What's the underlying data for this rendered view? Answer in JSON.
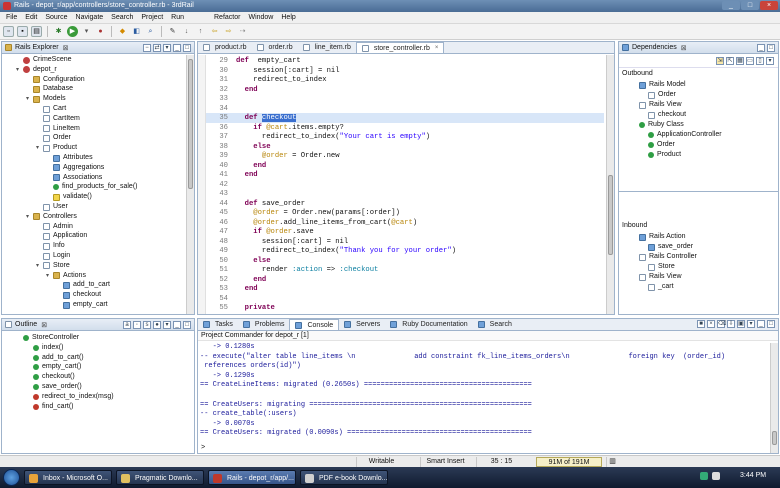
{
  "window": {
    "title": "Rails - depot_r/app/controllers/store_controller.rb - 3rdRail"
  },
  "menu": [
    "File",
    "Edit",
    "Source",
    "Navigate",
    "Search",
    "Project",
    "Run",
    "Refactor",
    "Window",
    "Help"
  ],
  "explorer": {
    "title": "Rails Explorer",
    "items": [
      {
        "label": "CrimeScene",
        "indent": 1,
        "icon": "db",
        "twisty": ""
      },
      {
        "label": "depot_r",
        "indent": 1,
        "icon": "db",
        "twisty": "▾"
      },
      {
        "label": "Configuration",
        "indent": 2,
        "icon": "folder",
        "twisty": ""
      },
      {
        "label": "Database",
        "indent": 2,
        "icon": "folder",
        "twisty": ""
      },
      {
        "label": "Models",
        "indent": 2,
        "icon": "folder",
        "twisty": "▾"
      },
      {
        "label": "Cart",
        "indent": 3,
        "icon": "file",
        "twisty": ""
      },
      {
        "label": "CartItem",
        "indent": 3,
        "icon": "file",
        "twisty": ""
      },
      {
        "label": "LineItem",
        "indent": 3,
        "icon": "file",
        "twisty": ""
      },
      {
        "label": "Order",
        "indent": 3,
        "icon": "file",
        "twisty": ""
      },
      {
        "label": "Product",
        "indent": 3,
        "icon": "file",
        "twisty": "▾"
      },
      {
        "label": "Attributes",
        "indent": 4,
        "icon": "blue",
        "twisty": ""
      },
      {
        "label": "Aggregations",
        "indent": 4,
        "icon": "blue",
        "twisty": ""
      },
      {
        "label": "Associations",
        "indent": 4,
        "icon": "blue",
        "twisty": ""
      },
      {
        "label": "find_products_for_sale()",
        "indent": 4,
        "icon": "dot",
        "twisty": ""
      },
      {
        "label": "validate()",
        "indent": 4,
        "icon": "yellow",
        "twisty": ""
      },
      {
        "label": "User",
        "indent": 3,
        "icon": "file",
        "twisty": ""
      },
      {
        "label": "Controllers",
        "indent": 2,
        "icon": "folder",
        "twisty": "▾"
      },
      {
        "label": "Admin",
        "indent": 3,
        "icon": "file",
        "twisty": ""
      },
      {
        "label": "Application",
        "indent": 3,
        "icon": "file",
        "twisty": ""
      },
      {
        "label": "Info",
        "indent": 3,
        "icon": "file",
        "twisty": ""
      },
      {
        "label": "Login",
        "indent": 3,
        "icon": "file",
        "twisty": ""
      },
      {
        "label": "Store",
        "indent": 3,
        "icon": "file",
        "twisty": "▾"
      },
      {
        "label": "Actions",
        "indent": 4,
        "icon": "folder",
        "twisty": "▾"
      },
      {
        "label": "add_to_cart",
        "indent": 5,
        "icon": "blue",
        "twisty": ""
      },
      {
        "label": "checkout",
        "indent": 5,
        "icon": "blue",
        "twisty": ""
      },
      {
        "label": "empty_cart",
        "indent": 5,
        "icon": "blue",
        "twisty": ""
      }
    ]
  },
  "outline": {
    "title": "Outline",
    "items": [
      {
        "label": "StoreController",
        "indent": 1,
        "icon": "dot"
      },
      {
        "label": "index()",
        "indent": 2,
        "icon": "dot"
      },
      {
        "label": "add_to_cart()",
        "indent": 2,
        "icon": "dot"
      },
      {
        "label": "empty_cart()",
        "indent": 2,
        "icon": "dot"
      },
      {
        "label": "checkout()",
        "indent": 2,
        "icon": "dot"
      },
      {
        "label": "save_order()",
        "indent": 2,
        "icon": "dot"
      },
      {
        "label": "redirect_to_index(msg)",
        "indent": 2,
        "icon": "reddot"
      },
      {
        "label": "find_cart()",
        "indent": 2,
        "icon": "reddot"
      }
    ]
  },
  "editor": {
    "tabs": [
      "product.rb",
      "order.rb",
      "line_item.rb",
      "store_controller.rb"
    ],
    "active_tab": 3,
    "lines": [
      {
        "n": "29",
        "segs": [
          [
            "kw",
            "def"
          ],
          [
            "",
            "  empty_cart"
          ]
        ]
      },
      {
        "n": "30",
        "segs": [
          [
            "",
            "    session[:cart] = nil"
          ]
        ]
      },
      {
        "n": "31",
        "segs": [
          [
            "",
            "    redirect_to_index"
          ]
        ]
      },
      {
        "n": "32",
        "segs": [
          [
            "kw",
            "  end"
          ]
        ]
      },
      {
        "n": "33",
        "segs": [
          [
            "",
            ""
          ]
        ]
      },
      {
        "n": "34",
        "segs": [
          [
            "",
            ""
          ]
        ]
      },
      {
        "n": "35",
        "segs": [
          [
            "kw",
            "  def "
          ],
          [
            "sel",
            "checkout"
          ]
        ]
      },
      {
        "n": "36",
        "segs": [
          [
            "kw",
            "    if "
          ],
          [
            "ivar",
            "@cart"
          ],
          [
            "",
            ".items.empty?"
          ]
        ]
      },
      {
        "n": "37",
        "segs": [
          [
            "",
            "      redirect_to_index("
          ],
          [
            "str",
            "\"Your cart is empty\""
          ],
          [
            "",
            ")"
          ]
        ]
      },
      {
        "n": "38",
        "segs": [
          [
            "kw",
            "    else"
          ]
        ]
      },
      {
        "n": "39",
        "segs": [
          [
            "ivar",
            "      @order"
          ],
          [
            "",
            " = Order.new"
          ]
        ]
      },
      {
        "n": "40",
        "segs": [
          [
            "kw",
            "    end"
          ]
        ]
      },
      {
        "n": "41",
        "segs": [
          [
            "kw",
            "  end"
          ]
        ]
      },
      {
        "n": "42",
        "segs": [
          [
            "",
            ""
          ]
        ]
      },
      {
        "n": "43",
        "segs": [
          [
            "",
            ""
          ]
        ]
      },
      {
        "n": "44",
        "segs": [
          [
            "kw",
            "  def "
          ],
          [
            "",
            "save_order"
          ]
        ]
      },
      {
        "n": "45",
        "segs": [
          [
            "ivar",
            "    @order"
          ],
          [
            "",
            " = Order.new(params[:order])"
          ]
        ]
      },
      {
        "n": "46",
        "segs": [
          [
            "ivar",
            "    @order"
          ],
          [
            "",
            ".add_line_items_from_cart("
          ],
          [
            "ivar",
            "@cart"
          ],
          [
            "",
            ")"
          ]
        ]
      },
      {
        "n": "47",
        "segs": [
          [
            "kw",
            "    if "
          ],
          [
            "ivar",
            "@order"
          ],
          [
            "",
            ".save"
          ]
        ]
      },
      {
        "n": "48",
        "segs": [
          [
            "",
            "      session[:cart] = nil"
          ]
        ]
      },
      {
        "n": "49",
        "segs": [
          [
            "",
            "      redirect_to_index("
          ],
          [
            "str",
            "\"Thank you for your order\""
          ],
          [
            "",
            ")"
          ]
        ]
      },
      {
        "n": "50",
        "segs": [
          [
            "kw",
            "    else"
          ]
        ]
      },
      {
        "n": "51",
        "segs": [
          [
            "",
            "      render "
          ],
          [
            "sym",
            ":action"
          ],
          [
            "",
            " => "
          ],
          [
            "sym",
            ":checkout"
          ]
        ]
      },
      {
        "n": "52",
        "segs": [
          [
            "kw",
            "    end"
          ]
        ]
      },
      {
        "n": "53",
        "segs": [
          [
            "kw",
            "  end"
          ]
        ]
      },
      {
        "n": "54",
        "segs": [
          [
            "",
            ""
          ]
        ]
      },
      {
        "n": "55",
        "segs": [
          [
            "kw",
            "  private"
          ]
        ]
      }
    ]
  },
  "dependencies": {
    "title": "Dependencies",
    "outbound_label": "Outbound",
    "outbound": [
      {
        "label": "Rails Model",
        "indent": 1,
        "icon": "blue"
      },
      {
        "label": "Order",
        "indent": 2,
        "icon": "file"
      },
      {
        "label": "Rails View",
        "indent": 1,
        "icon": "file"
      },
      {
        "label": "checkout",
        "indent": 2,
        "icon": "file"
      },
      {
        "label": "Ruby Class",
        "indent": 1,
        "icon": "dot"
      },
      {
        "label": "ApplicationController",
        "indent": 2,
        "icon": "dot"
      },
      {
        "label": "Order",
        "indent": 2,
        "icon": "dot"
      },
      {
        "label": "Product",
        "indent": 2,
        "icon": "dot"
      }
    ],
    "inbound_label": "Inbound",
    "inbound": [
      {
        "label": "Rails Action",
        "indent": 1,
        "icon": "blue"
      },
      {
        "label": "save_order",
        "indent": 2,
        "icon": "blue"
      },
      {
        "label": "Rails Controller",
        "indent": 1,
        "icon": "file"
      },
      {
        "label": "Store",
        "indent": 2,
        "icon": "file"
      },
      {
        "label": "Rails View",
        "indent": 1,
        "icon": "file"
      },
      {
        "label": "_cart",
        "indent": 2,
        "icon": "file"
      }
    ]
  },
  "bottom": {
    "tabs": [
      "Tasks",
      "Problems",
      "Console",
      "Servers",
      "Ruby Documentation",
      "Search"
    ],
    "active_tab": 2,
    "console_title": "Project Commander for depot_r [1]",
    "console_lines": [
      "   -> 0.1280s",
      "-- execute(\"alter table line_items \\n              add constraint fk_line_items_orders\\n              foreign key  (order_id)",
      " references orders(id)\")",
      "   -> 0.1290s",
      "== CreateLineItems: migrated (0.2650s) ========================================",
      "",
      "== CreateUsers: migrating =====================================================",
      "-- create_table(:users)",
      "   -> 0.0070s",
      "== CreateUsers: migrated (0.0090s) ============================================"
    ],
    "prompt": ">"
  },
  "status": {
    "writable": "Writable",
    "insert_mode": "Smart Insert",
    "position": "35 : 15",
    "memory": "91M of 191M"
  },
  "taskbar": {
    "tasks": [
      "Inbox - Microsoft O...",
      "Pragmatic Downlo...",
      "Rails - depot_r/app/...",
      "PDF e-book Downlo..."
    ],
    "active": 2,
    "clock": "3:44 PM"
  }
}
